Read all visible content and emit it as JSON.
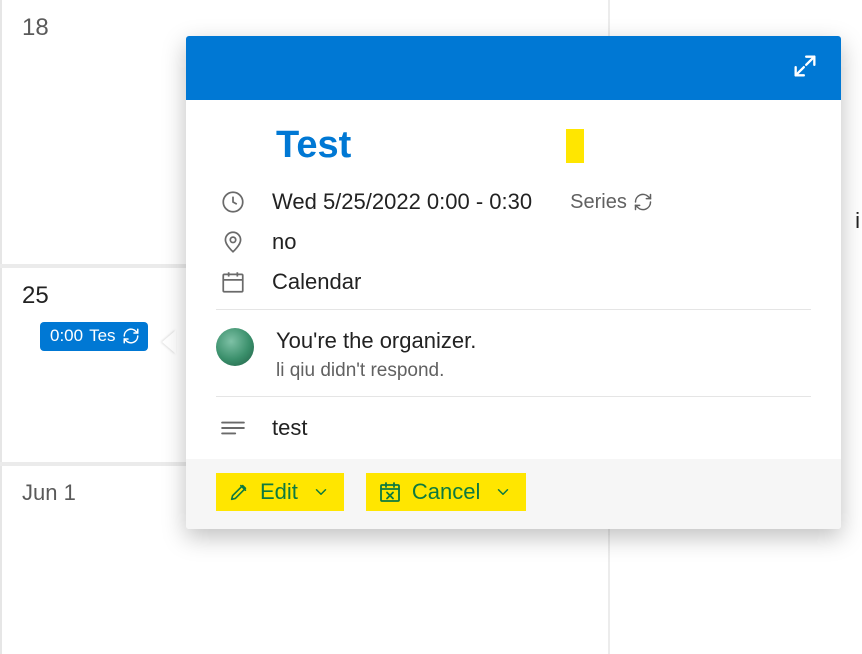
{
  "calendar": {
    "days": [
      {
        "label": "18"
      },
      {
        "label": "25"
      },
      {
        "label": "Jun 1"
      }
    ],
    "right_stub": "i"
  },
  "event_chip": {
    "time": "0:00",
    "title": "Tes"
  },
  "popover": {
    "title": "Test",
    "datetime": "Wed 5/25/2022 0:00 - 0:30",
    "series_label": "Series",
    "location": "no",
    "calendar_name": "Calendar",
    "organizer_line": "You're the organizer.",
    "response_line": "li qiu didn't respond.",
    "description": "test",
    "edit_label": "Edit",
    "cancel_label": "Cancel"
  }
}
